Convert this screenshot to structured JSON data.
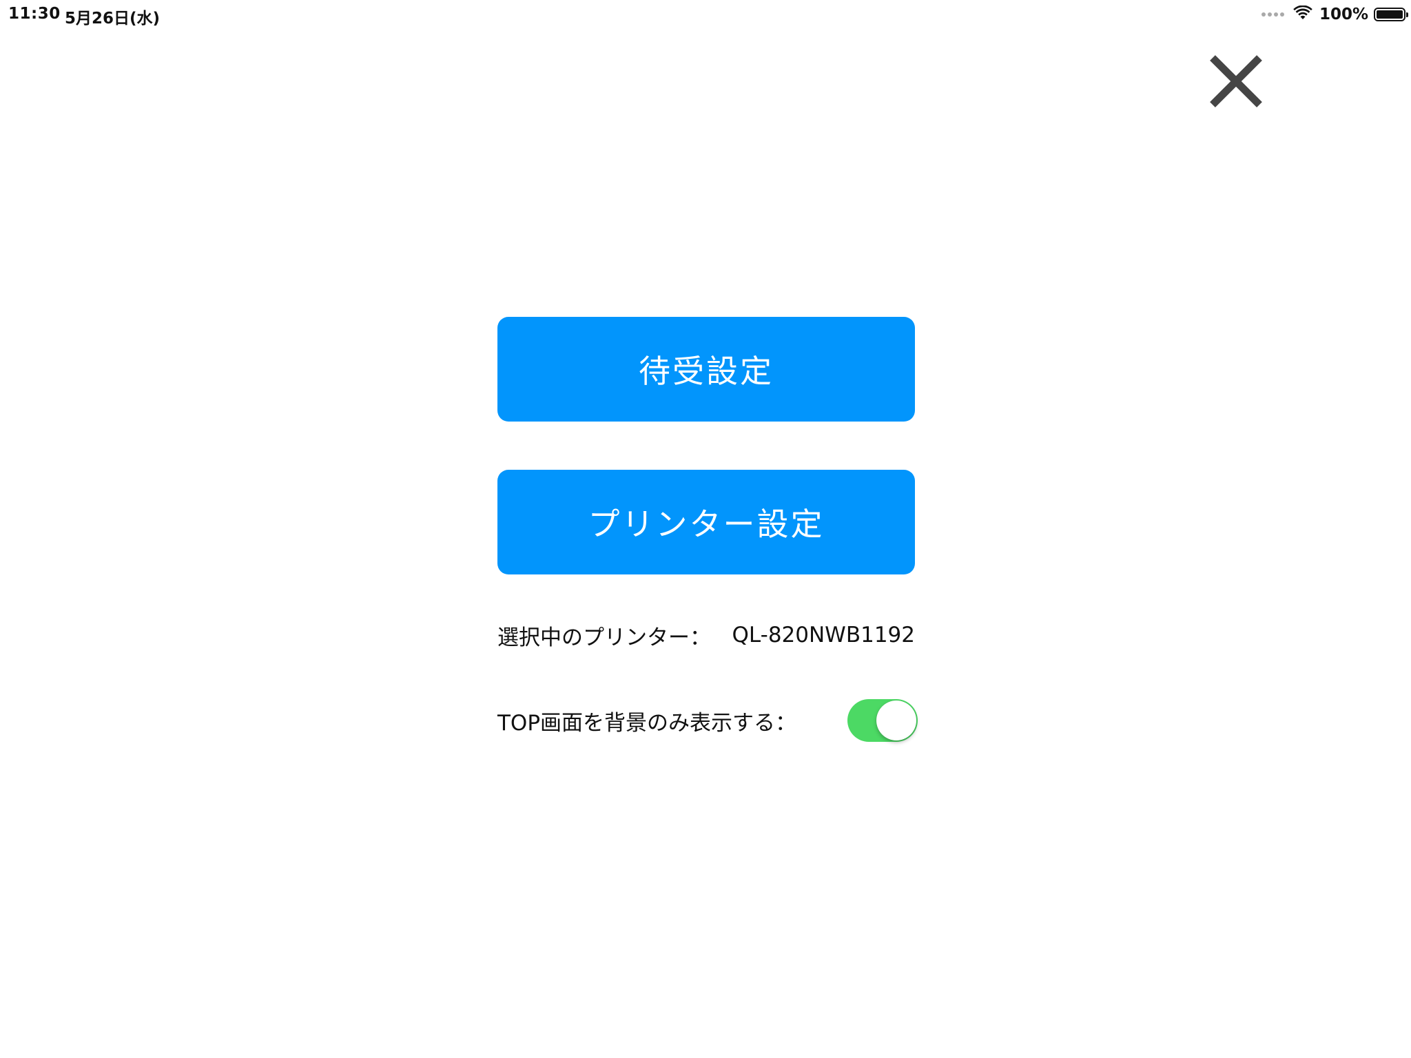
{
  "status_bar": {
    "time": "11:30",
    "date": "5月26日(水)",
    "battery_percent": "100%",
    "battery_level": 1.0,
    "wifi_icon": "wifi-icon",
    "signal_icon": "signal-dots-icon",
    "battery_icon": "battery-icon"
  },
  "close": {
    "icon": "close-icon",
    "color": "#454545"
  },
  "buttons": {
    "standby_label": "待受設定",
    "printer_label": "プリンター設定",
    "color": "#0295fc",
    "text_color": "#ffffff"
  },
  "printer": {
    "label": "選択中のプリンター：",
    "value": "QL-820NWB1192"
  },
  "top_screen_toggle": {
    "label": "TOP画面を背景のみ表示する：",
    "on": true,
    "on_color": "#4cd964"
  }
}
